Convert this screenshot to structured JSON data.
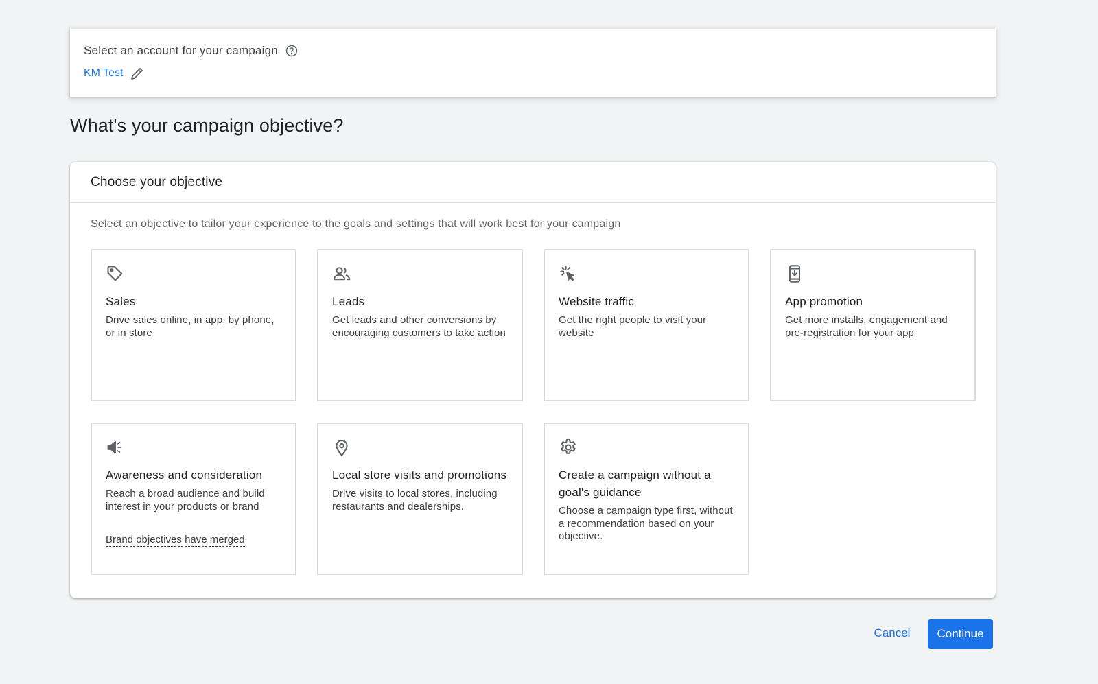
{
  "account": {
    "label": "Select an account for your campaign",
    "name": "KM Test",
    "help_icon": "help-circle-icon",
    "edit_icon": "pencil-icon"
  },
  "page_title": "What's your campaign objective?",
  "panel": {
    "title": "Choose your objective",
    "subtitle": "Select an objective to tailor your experience to the goals and settings that will work best for your campaign"
  },
  "objectives": [
    {
      "icon": "tag-icon",
      "title": "Sales",
      "description": "Drive sales online, in app, by phone, or in store"
    },
    {
      "icon": "people-icon",
      "title": "Leads",
      "description": "Get leads and other conversions by encouraging customers to take action"
    },
    {
      "icon": "click-cursor-icon",
      "title": "Website traffic",
      "description": "Get the right people to visit your website"
    },
    {
      "icon": "phone-download-icon",
      "title": "App promotion",
      "description": "Get more installs, engagement and pre-registration for your app"
    },
    {
      "icon": "megaphone-icon",
      "title": "Awareness and consideration",
      "description": "Reach a broad audience and build interest in your products or brand",
      "link": "Brand objectives have merged"
    },
    {
      "icon": "location-pin-icon",
      "title": "Local store visits and promotions",
      "description": "Drive visits to local stores, including restaurants and dealerships."
    },
    {
      "icon": "gear-icon",
      "title": "Create a campaign without a goal's guidance",
      "description": "Choose a campaign type first, without a recommendation based on your objective."
    }
  ],
  "actions": {
    "cancel_label": "Cancel",
    "continue_label": "Continue"
  },
  "colors": {
    "accent": "#1a73e8",
    "background": "#f1f3f4",
    "card_border": "#dadce0"
  }
}
